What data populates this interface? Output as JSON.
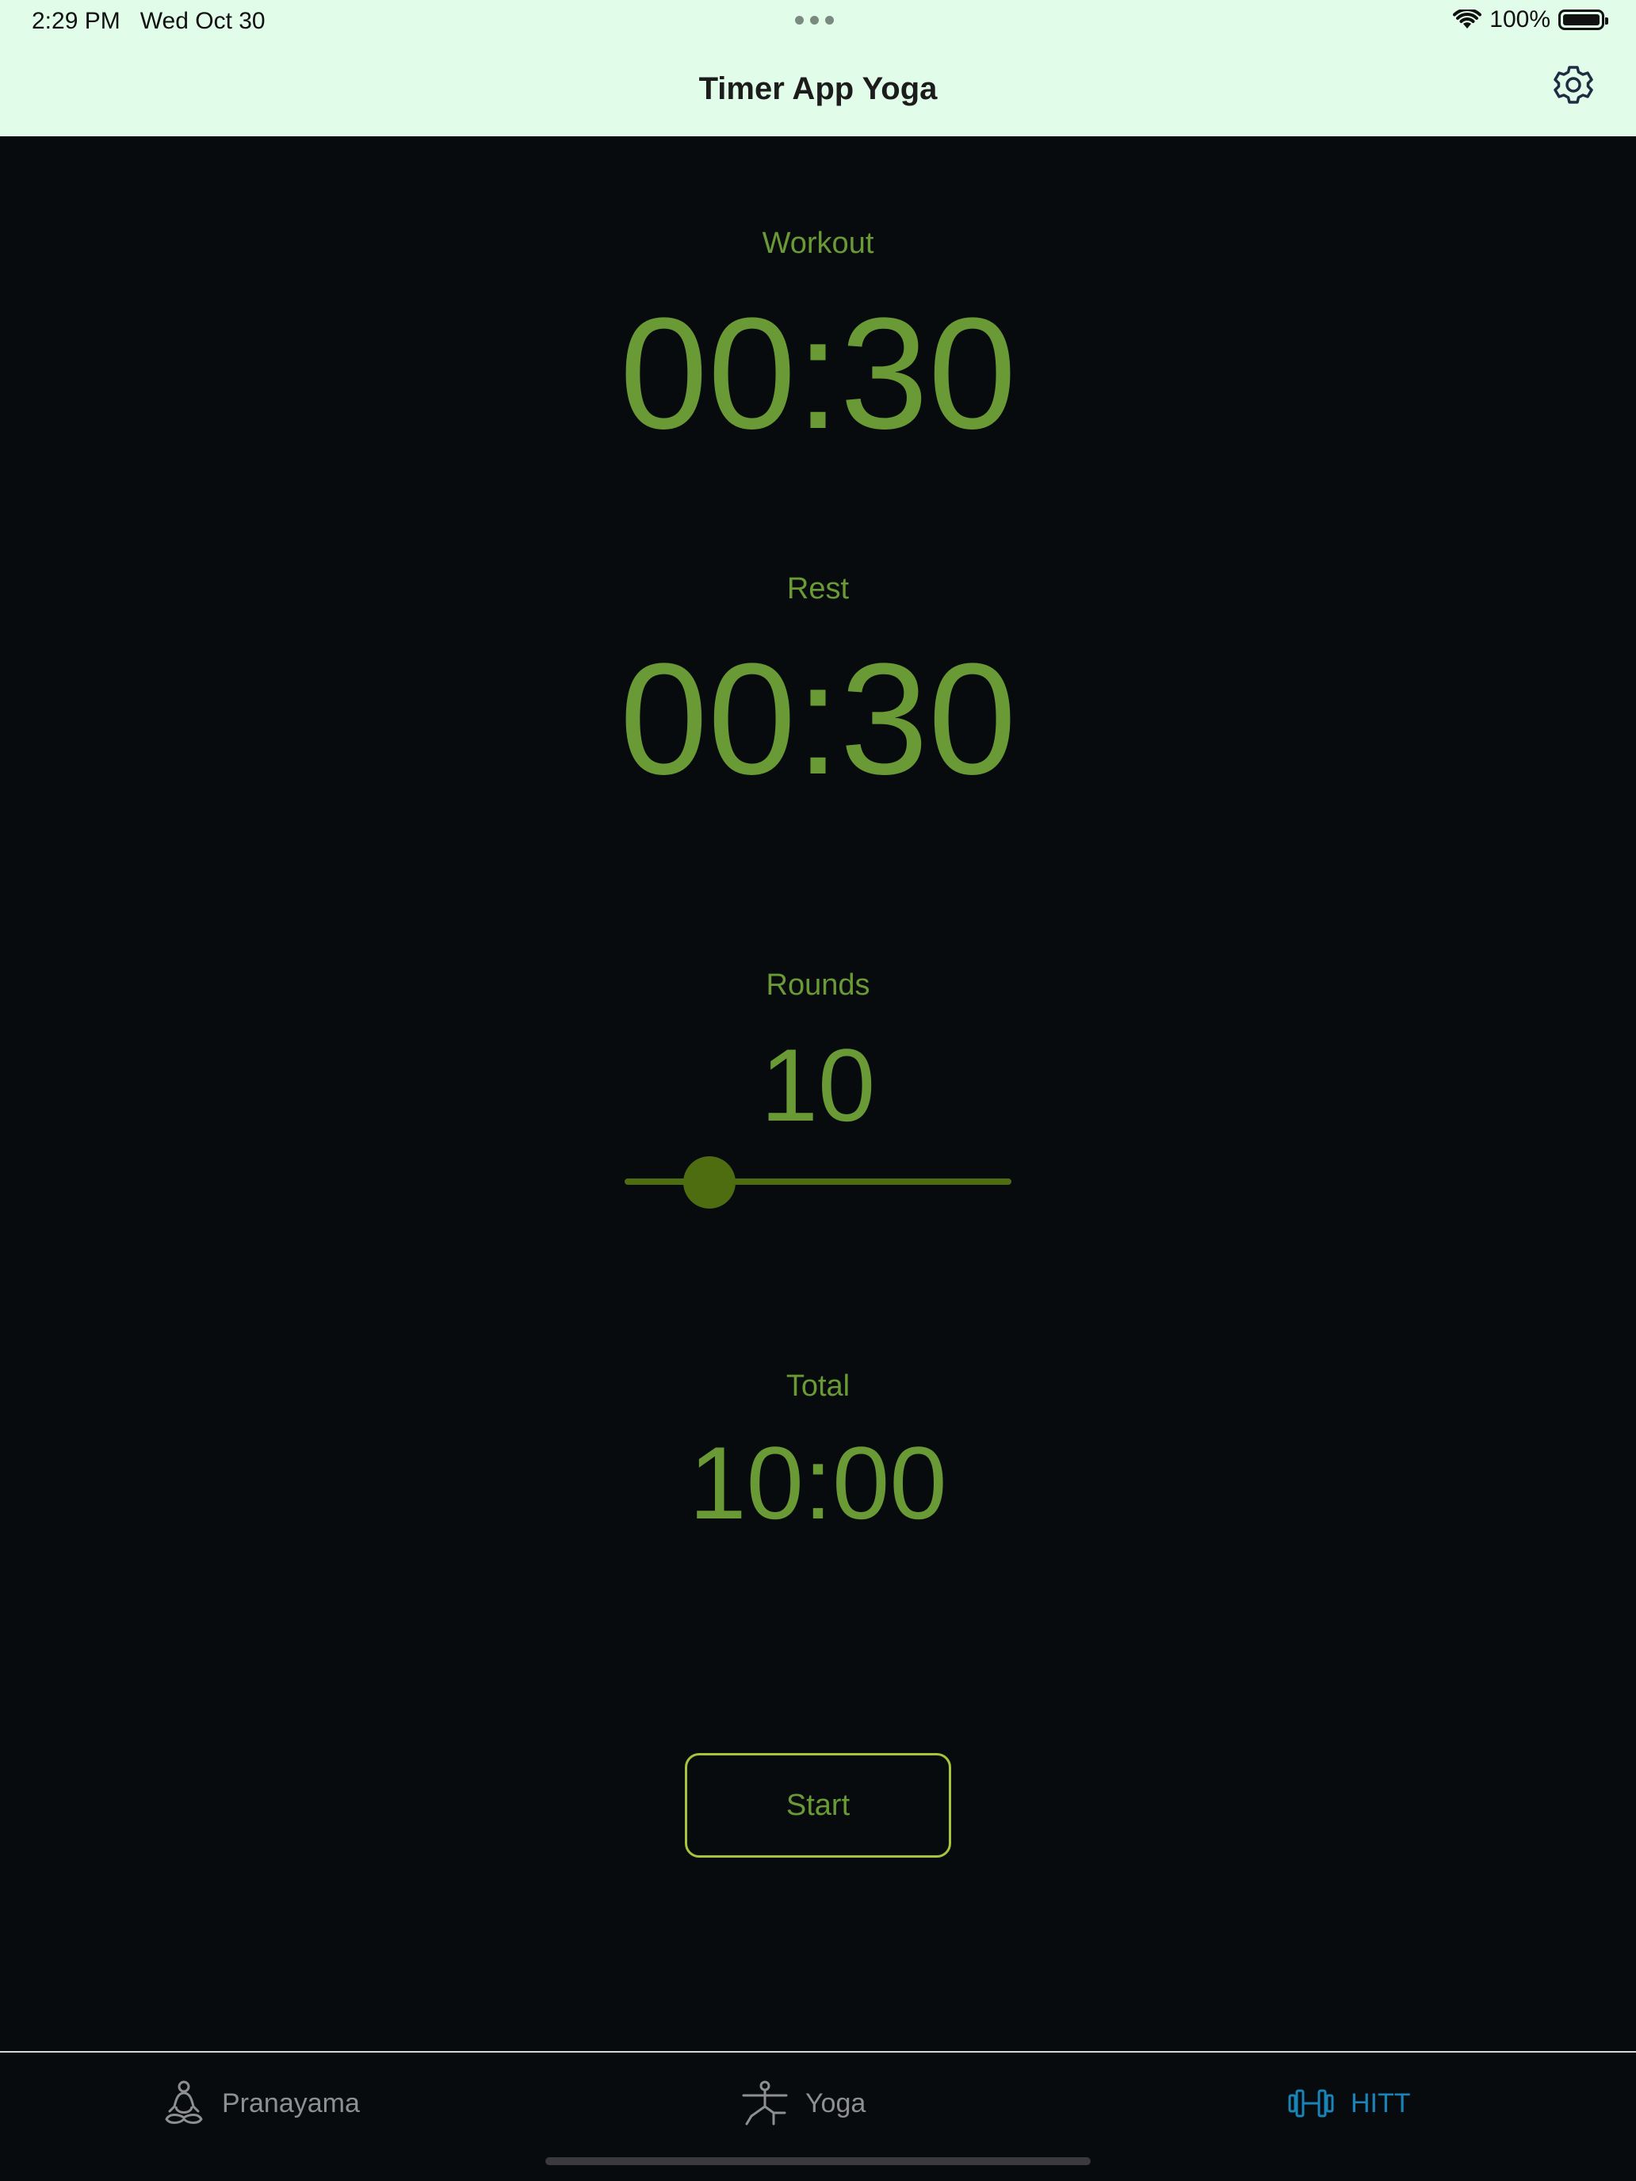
{
  "status_bar": {
    "time": "2:29 PM",
    "date": "Wed Oct 30",
    "battery": "100%",
    "icons": [
      "wifi-icon",
      "battery-icon"
    ]
  },
  "header": {
    "title": "Timer App Yoga",
    "settings_icon": "gear-icon"
  },
  "timer": {
    "workout_label": "Workout",
    "workout_value": "00:30",
    "rest_label": "Rest",
    "rest_value": "00:30",
    "rounds_label": "Rounds",
    "rounds_value": "10",
    "rounds_slider_fraction": 0.22,
    "total_label": "Total",
    "total_value": "10:00",
    "start_label": "Start"
  },
  "tabs": [
    {
      "label": "Pranayama",
      "icon": "meditation-icon",
      "selected": false
    },
    {
      "label": "Yoga",
      "icon": "yoga-pose-icon",
      "selected": false
    },
    {
      "label": "HITT",
      "icon": "dumbbell-icon",
      "selected": true
    }
  ],
  "colors": {
    "header_bg": "#e1fde9",
    "background": "#070b0d",
    "accent_green": "#6a9a35",
    "slider": "#4e6d10",
    "button_border": "#a7c43a",
    "tab_selected": "#1a84b8",
    "tab_unselected": "#8e8e93"
  }
}
